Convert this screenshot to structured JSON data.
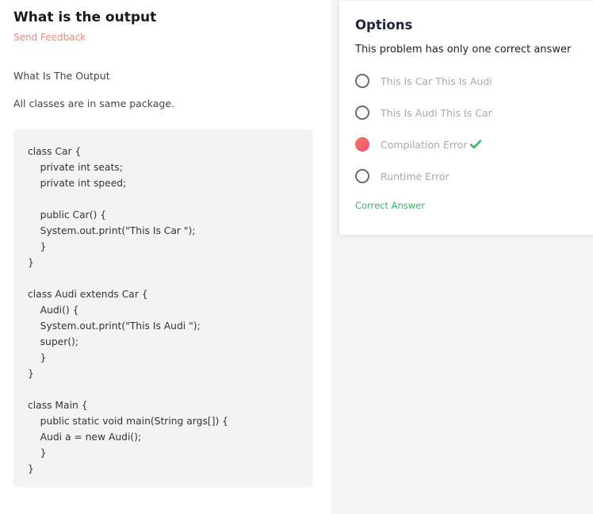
{
  "question": {
    "title": "What is the output",
    "feedback_link": "Send Feedback",
    "heading": "What Is The Output",
    "note": "All classes are in same package."
  },
  "code_lines": [
    "class Car {",
    "    private int seats;",
    "    private int speed;",
    "",
    "    public Car() {",
    "    System.out.print(\"This Is Car \");",
    "    }",
    "}",
    "",
    "class Audi extends Car {",
    "    Audi() {",
    "    System.out.print(\"This Is Audi \");",
    "    super();",
    "    }",
    "}",
    "",
    "class Main {",
    "    public static void main(String args[]) {",
    "    Audi a = new Audi();",
    "    }",
    "}"
  ],
  "options_panel": {
    "heading": "Options",
    "subtitle": "This problem has only one correct answer",
    "options": [
      {
        "label": "This Is Car This Is Audi",
        "selected": false
      },
      {
        "label": "This Is Audi This Is Car",
        "selected": false
      },
      {
        "label": "Compilation Error",
        "selected": true,
        "correct_icon": "check-icon"
      },
      {
        "label": "Runtime Error",
        "selected": false
      }
    ],
    "correct_answer_label": "Correct Answer"
  },
  "colors": {
    "feedback": "#f08a80",
    "selected_radio": "#f26b6b",
    "correct": "#3cb768",
    "option_text": "#a9a9a9"
  }
}
